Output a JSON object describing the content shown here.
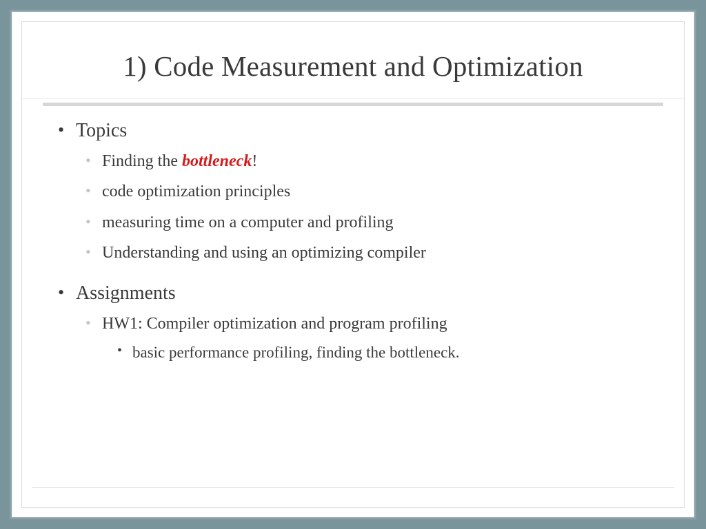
{
  "slide": {
    "title": "1) Code Measurement and Optimization",
    "sections": [
      {
        "heading": "Topics",
        "items": [
          {
            "pre": "Finding the ",
            "emph": "bottleneck",
            "post": "!"
          },
          {
            "text": "code optimization principles"
          },
          {
            "text": "measuring time on a computer and profiling"
          },
          {
            "text": "Understanding and using an optimizing compiler"
          }
        ]
      },
      {
        "heading": "Assignments",
        "items": [
          {
            "text": "HW1: Compiler optimization and program profiling",
            "subitems": [
              {
                "text": "basic performance profiling, finding the bottleneck."
              }
            ]
          }
        ]
      }
    ]
  },
  "colors": {
    "frame": "#7a949c",
    "accent": "#d61a1a"
  }
}
